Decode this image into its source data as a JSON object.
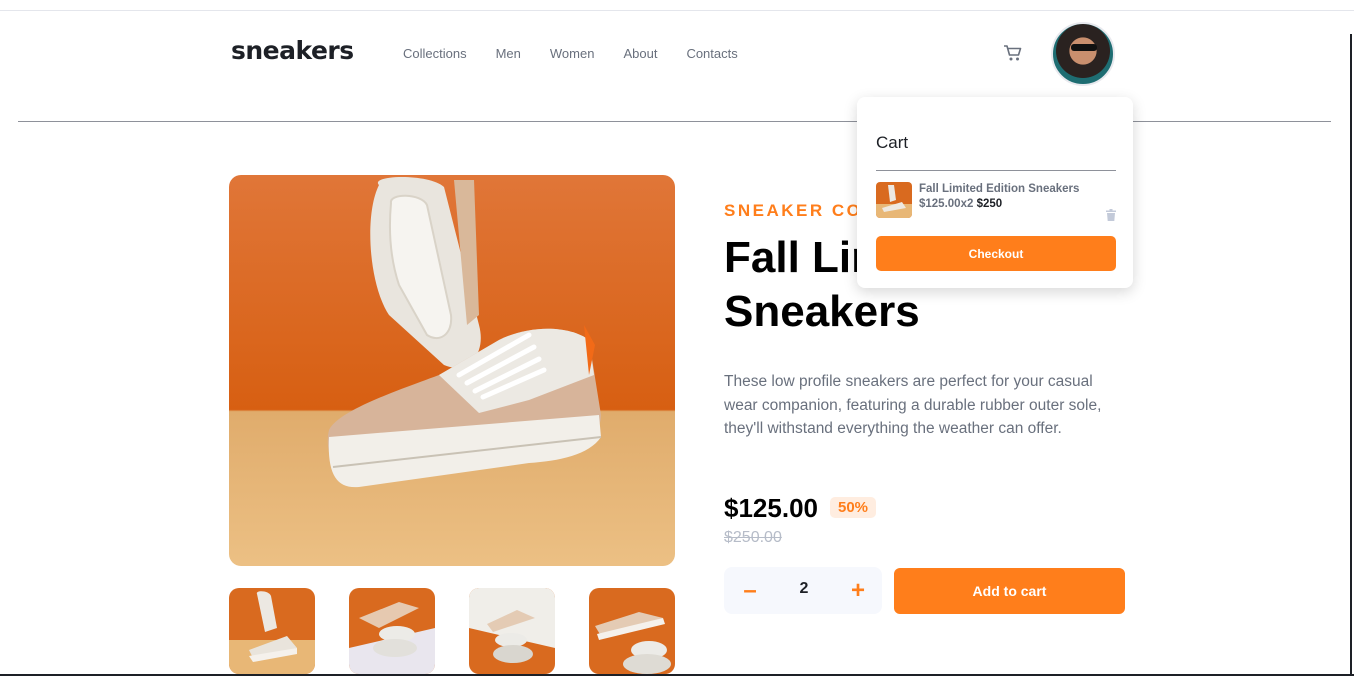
{
  "header": {
    "logo": "sneakers",
    "nav": [
      "Collections",
      "Men",
      "Women",
      "About",
      "Contacts"
    ],
    "cart_icon": "cart-icon",
    "avatar_icon": "user-avatar"
  },
  "product": {
    "company": "SNEAKER CO",
    "title": "Fall Limited Edition Sneakers",
    "title_visible": "Fall Lir",
    "title_line2": "Sneakers",
    "description": "These low profile sneakers are perfect for your casual wear companion, featuring a durable rubber outer sole, they'll withstand everything the weather can offer.",
    "price": "$125.00",
    "discount": "50%",
    "old_price": "$250.00",
    "quantity": "2",
    "minus_label": "–",
    "plus_label": "+",
    "add_to_cart": "Add to cart"
  },
  "cart": {
    "heading": "Cart",
    "item_name": "Fall Limited Edition Sneakers",
    "item_calc": "$125.00x2",
    "item_total": "$250",
    "checkout": "Checkout",
    "delete_icon": "trash-icon"
  },
  "colors": {
    "accent": "#ff7e1b",
    "accent_light": "#ffede0",
    "text_dark": "#1d2026",
    "text_muted": "#69707d",
    "text_faint": "#b6bcc8"
  }
}
